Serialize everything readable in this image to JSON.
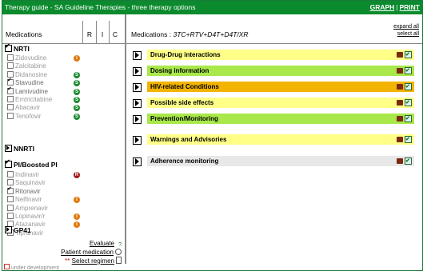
{
  "window": {
    "title": "Therapy guide - SA Guideline Therapies - three therapy options",
    "links": [
      {
        "label": "GRAPH"
      },
      {
        "label": "PRINT"
      }
    ]
  },
  "left": {
    "headers": {
      "medications": "Medications",
      "r": "R",
      "i": "I",
      "c": "C"
    },
    "groups": {
      "nrti": {
        "label": "NRTI",
        "checked": true
      },
      "nnrti": {
        "label": "NNRTI"
      },
      "pi": {
        "label": "PI/Boosted PI",
        "checked": true
      },
      "gp41": {
        "label": "GP41"
      }
    },
    "nrti_drugs": [
      {
        "name": "Zidovudine",
        "checked": false,
        "badge": "orange",
        "badge_text": "I"
      },
      {
        "name": "Zalcitabine",
        "checked": false,
        "badge": "",
        "badge_text": ""
      },
      {
        "name": "Didanosine",
        "checked": false,
        "badge": "green",
        "badge_text": "S"
      },
      {
        "name": "Stavudine",
        "checked": true,
        "badge": "green",
        "badge_text": "S"
      },
      {
        "name": "Lamivudine",
        "checked": true,
        "badge": "green",
        "badge_text": "S"
      },
      {
        "name": "Emtricitabine",
        "checked": false,
        "badge": "green",
        "badge_text": "S"
      },
      {
        "name": "Abacavir",
        "checked": false,
        "badge": "green",
        "badge_text": "S"
      },
      {
        "name": "Tenofovir",
        "checked": false,
        "badge": "green",
        "badge_text": "S"
      }
    ],
    "pi_drugs": [
      {
        "name": "Indinavir",
        "checked": false,
        "badge": "red",
        "badge_text": "R"
      },
      {
        "name": "Saquinavir",
        "checked": false,
        "badge": "",
        "badge_text": ""
      },
      {
        "name": "Ritonavir",
        "checked": true,
        "badge": "",
        "badge_text": ""
      },
      {
        "name": "Nelfinavir",
        "checked": false,
        "badge": "orange",
        "badge_text": "I"
      },
      {
        "name": "Amprenavir",
        "checked": false,
        "badge": "",
        "badge_text": ""
      },
      {
        "name": "Lopinavir/r",
        "checked": false,
        "badge": "orange",
        "badge_text": "I"
      },
      {
        "name": "Atazanavir",
        "checked": false,
        "badge": "orange",
        "badge_text": "I"
      },
      {
        "name": "Tipranavir",
        "checked": false,
        "badge": "",
        "badge_text": ""
      }
    ],
    "footer": {
      "evaluate": "Evaluate",
      "patient_medication": "Patient medication",
      "select_regimen": "Select regimen",
      "required_mark": "**"
    },
    "under_development": "under development"
  },
  "right": {
    "medications_label": "Medications :",
    "medications_value": "3TC+RTV+D4T+D4T/XR",
    "expand_all": "expand all",
    "select_all": "select all",
    "sections": [
      {
        "label": "Drug-Drug interactions",
        "color": "#ffff88"
      },
      {
        "label": "Dosing information",
        "color": "#a8e84a"
      },
      {
        "label": "HIV-related Conditions",
        "color": "#f2b400"
      },
      {
        "label": "Possible side effects",
        "color": "#ffff88"
      },
      {
        "label": "Prevention/Monitoring",
        "color": "#a8e84a"
      },
      {
        "label": "Warnings and Advisories",
        "color": "#ffff88"
      },
      {
        "label": "Adherence monitoring",
        "color": "#e8e8e8"
      }
    ]
  }
}
